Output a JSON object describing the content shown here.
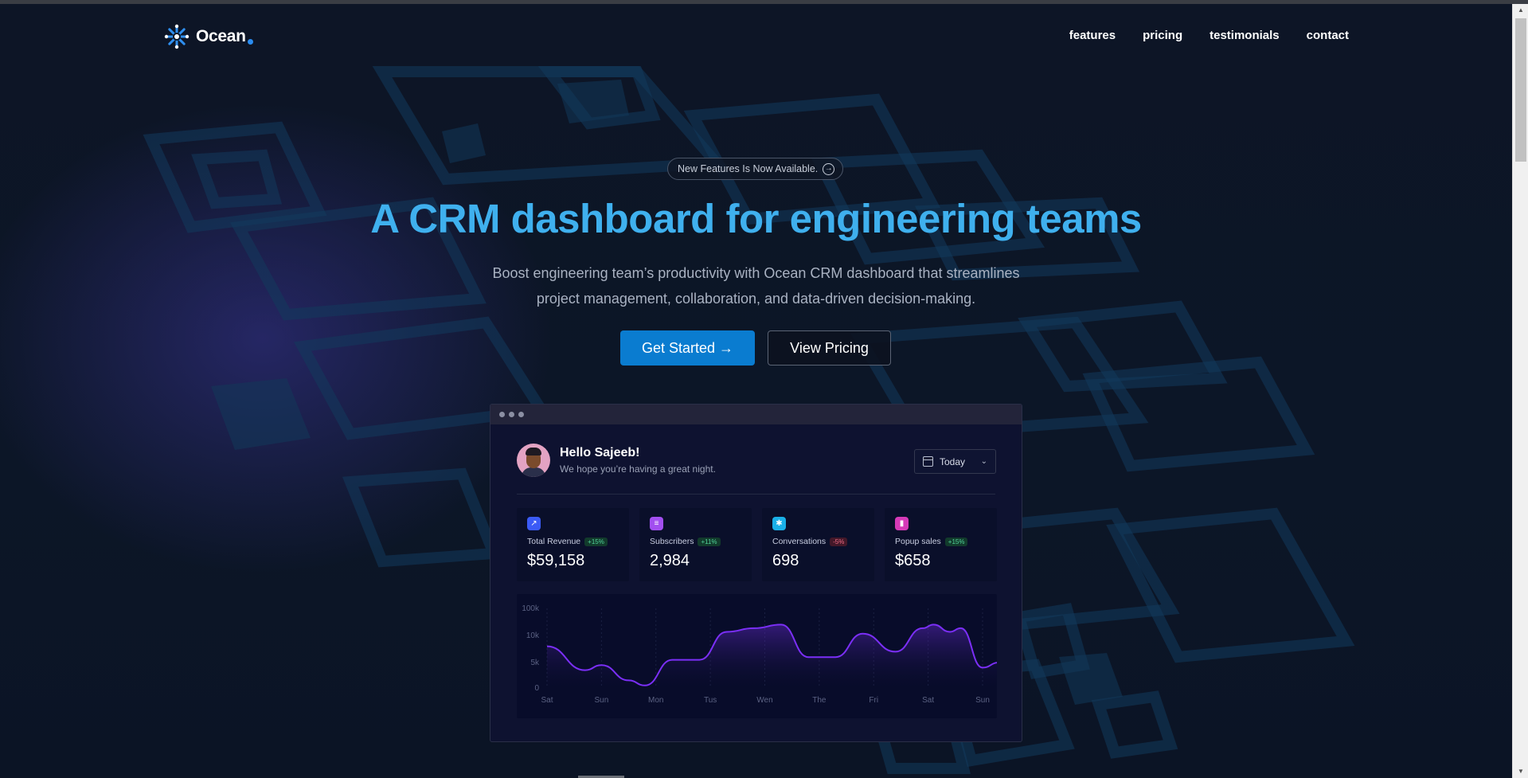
{
  "brand": {
    "name": "Ocean"
  },
  "nav": [
    {
      "label": "features"
    },
    {
      "label": "pricing"
    },
    {
      "label": "testimonials"
    },
    {
      "label": "contact"
    }
  ],
  "hero": {
    "badge": "New Features Is Now Available.",
    "title": "A CRM dashboard for engineering teams",
    "subtitle_line1": "Boost engineering team’s productivity with Ocean CRM dashboard that streamlines",
    "subtitle_line2": "project management, collaboration, and data-driven decision-making.",
    "primary_cta": "Get Started →",
    "secondary_cta": "View Pricing"
  },
  "dashboard": {
    "greeting": "Hello Sajeeb!",
    "greeting_sub": "We hope you’re having a great night.",
    "date_filter": "Today",
    "stats": [
      {
        "label": "Total Revenue",
        "change": "+15%",
        "trend": "up",
        "value": "$59,158",
        "icon": "chart-trend-icon",
        "color": "#3b5bf6"
      },
      {
        "label": "Subscribers",
        "change": "+11%",
        "trend": "up",
        "value": "2,984",
        "icon": "document-icon",
        "color": "#a24ff0"
      },
      {
        "label": "Conversations",
        "change": "-5%",
        "trend": "down",
        "value": "698",
        "icon": "shield-icon",
        "color": "#1ab0e8"
      },
      {
        "label": "Popup sales",
        "change": "+15%",
        "trend": "up",
        "value": "$658",
        "icon": "bar-chart-icon",
        "color": "#d63ab8"
      }
    ]
  },
  "chart_data": {
    "type": "area",
    "y_ticks": [
      "0",
      "5k",
      "10k",
      "100k"
    ],
    "categories": [
      "Sat",
      "Sun",
      "Mon",
      "Tus",
      "Wen",
      "The",
      "Fri",
      "Sat",
      "Sun"
    ],
    "x": [
      0,
      0.7,
      1.0,
      1.5,
      1.8,
      2.3,
      2.8,
      3.3,
      3.8,
      4.3,
      4.8,
      5.3,
      5.8,
      6.4,
      6.9,
      7.1,
      7.4,
      7.6,
      8.0,
      8.3,
      8.5
    ],
    "series": [
      {
        "values": [
          8,
          3.5,
          4.5,
          1.5,
          0.5,
          5.5,
          5.5,
          11,
          12,
          13,
          6,
          6,
          10.5,
          7,
          12,
          13,
          11,
          12,
          4,
          5,
          5.5
        ]
      }
    ],
    "line_color": "#7b2ff7",
    "grid": true
  }
}
